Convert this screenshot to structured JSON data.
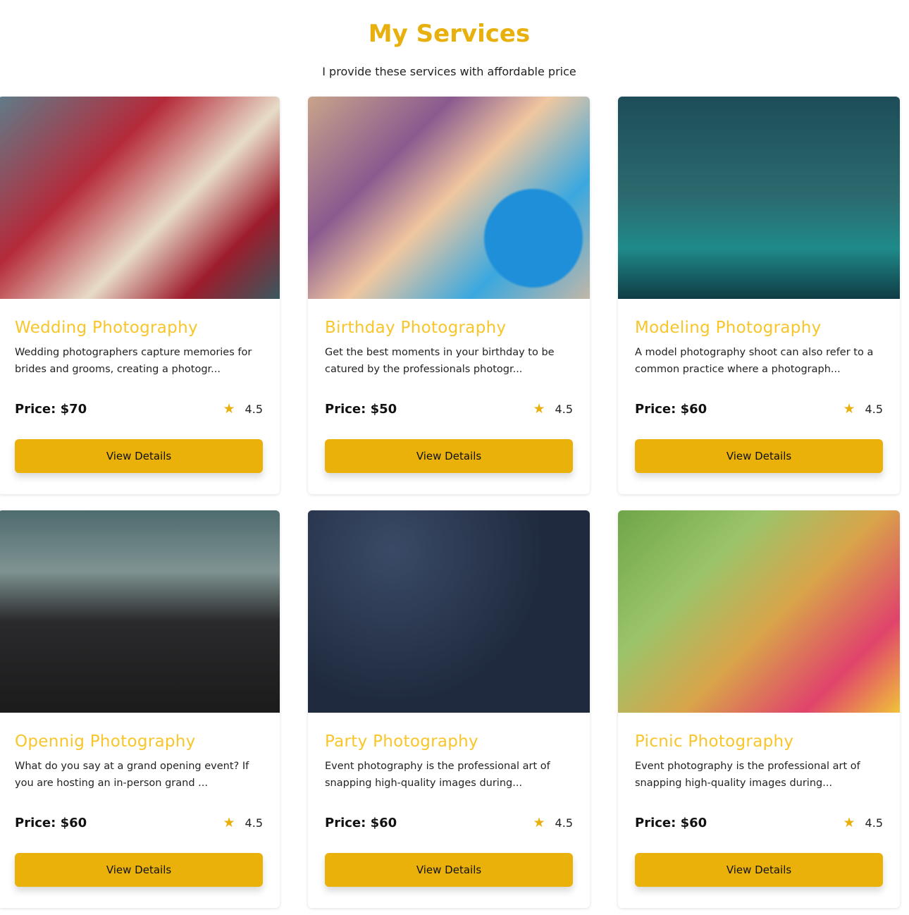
{
  "header": {
    "title": "My Services",
    "subtitle": "I provide these services with affordable price"
  },
  "accent": "#e9b10a",
  "services": [
    {
      "title": "Wedding Photography",
      "description": "Wedding photographers capture memories for brides and grooms, creating a photogr...",
      "price": "Price: $70",
      "rating": "4.5",
      "button": "View Details",
      "image": "wedding couple photo"
    },
    {
      "title": "Birthday Photography",
      "description": "Get the best moments in your birthday to be catured by the professionals photogr...",
      "price": "Price: $50",
      "rating": "4.5",
      "button": "View Details",
      "image": "baby birthday photo"
    },
    {
      "title": "Modeling Photography",
      "description": "A model photography shoot can also refer to a common practice where a photograph...",
      "price": "Price: $60",
      "rating": "4.5",
      "button": "View Details",
      "image": "model in field photo"
    },
    {
      "title": "Opennig Photography",
      "description": "What do you say at a grand opening event? If you are hosting an in-person grand ...",
      "price": "Price: $60",
      "rating": "4.5",
      "button": "View Details",
      "image": "ribbon cutting photo"
    },
    {
      "title": "Party Photography",
      "description": "Event photography is the professional art of snapping high-quality images during...",
      "price": "Price: $60",
      "rating": "4.5",
      "button": "View Details",
      "image": "party confetti photo"
    },
    {
      "title": "Picnic Photography",
      "description": "Event photography is the professional art of snapping high-quality images during...",
      "price": "Price: $60",
      "rating": "4.5",
      "button": "View Details",
      "image": "picnic in park photo"
    }
  ]
}
